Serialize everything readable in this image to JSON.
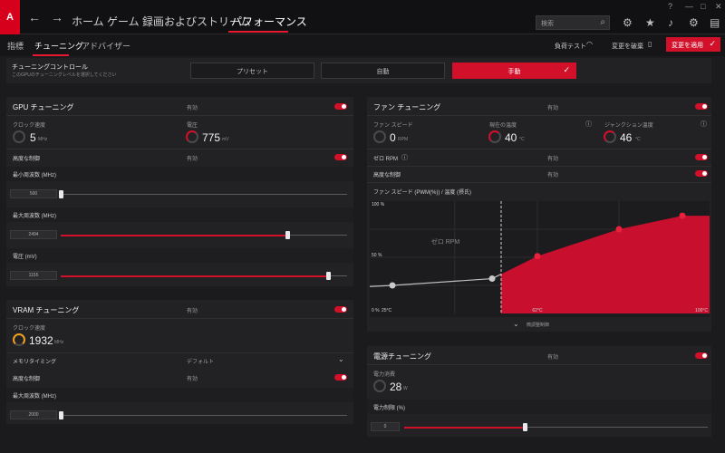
{
  "nav": {
    "items": [
      "ホーム",
      "ゲーム",
      "録画およびストリーム",
      "パフォーマンス"
    ],
    "search_placeholder": "検索"
  },
  "subnav": {
    "tabs": [
      "指標",
      "チューニング",
      "アドバイザー"
    ],
    "load_test": "負荷テスト",
    "discard": "変更を破棄",
    "apply": "変更を適用"
  },
  "tuning_control": {
    "title": "チューニングコントロール",
    "subtitle": "このGPUのチューニングレベルを選択してください",
    "modes": [
      "プリセット",
      "自動",
      "手動"
    ],
    "selected": "手動"
  },
  "gpu": {
    "title": "GPU チューニング",
    "status": "有効",
    "clock_label": "クロック速度",
    "clock_value": "5",
    "clock_unit": "MHz",
    "voltage_label": "電圧",
    "voltage_value": "775",
    "voltage_unit": "mV",
    "advanced_label": "高度な制御",
    "advanced_status": "有効",
    "min_freq_label": "最小周波数 (MHz)",
    "min_freq_value": "500",
    "max_freq_label": "最大周波数 (MHz)",
    "max_freq_value": "2494",
    "volt_label": "電圧 (mV)",
    "volt_value": "1155"
  },
  "vram": {
    "title": "VRAM チューニング",
    "status": "有効",
    "clock_label": "クロック速度",
    "clock_value": "1932",
    "clock_unit": "MHz",
    "timing_label": "メモリタイミング",
    "timing_value": "デフォルト",
    "advanced_label": "高度な制御",
    "advanced_status": "有効",
    "max_freq_label": "最大周波数 (MHz)",
    "max_freq_value": "2000"
  },
  "fan": {
    "title": "ファン チューニング",
    "status": "有効",
    "speed_label": "ファン スピード",
    "speed_value": "0",
    "speed_unit": "RPM",
    "temp_label": "現在の温度",
    "temp_value": "40",
    "temp_unit": "°C",
    "junction_label": "ジャンクション温度",
    "junction_value": "46",
    "junction_unit": "°C",
    "zero_rpm_label": "ゼロ RPM",
    "zero_rpm_status": "有効",
    "advanced_label": "高度な制御",
    "advanced_status": "有効",
    "curve_label": "ファン スピード (PWM(%)) / 温度 (摂氏)",
    "curve_zero_rpm": "ゼロ RPM",
    "fine_adjust": "微調整制御"
  },
  "power": {
    "title": "電源チューニング",
    "status": "有効",
    "consumption_label": "電力消費",
    "consumption_value": "28",
    "consumption_unit": "W",
    "limit_label": "電力制限 (%)",
    "limit_value": "0"
  },
  "chart_data": {
    "type": "area",
    "x_ticks": [
      "25°C",
      "62°C",
      "100°C"
    ],
    "y_ticks": [
      "0 %",
      "50 %",
      "100 %"
    ],
    "zero_rpm_threshold_c": 54,
    "points": [
      {
        "temp": 30,
        "pwm": 25
      },
      {
        "temp": 52,
        "pwm": 31
      },
      {
        "temp": 62,
        "pwm": 51
      },
      {
        "temp": 80,
        "pwm": 75
      },
      {
        "temp": 94,
        "pwm": 87
      }
    ],
    "xlim": [
      25,
      100
    ],
    "ylim": [
      0,
      100
    ]
  }
}
